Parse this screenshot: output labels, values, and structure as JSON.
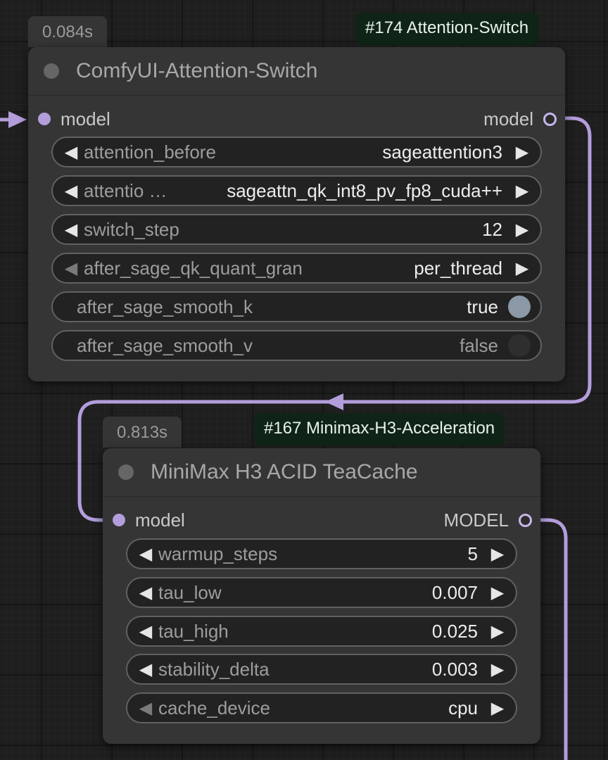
{
  "nodes": [
    {
      "timing": "0.084s",
      "badge": "#174 Attention-Switch",
      "title": "ComfyUI-Attention-Switch",
      "input": "model",
      "output": "model",
      "widgets": [
        {
          "label": "attention_before",
          "value": "sageattention3"
        },
        {
          "label": "attentio …",
          "value": "sageattn_qk_int8_pv_fp8_cuda++"
        },
        {
          "label": "switch_step",
          "value": "12"
        },
        {
          "label": "after_sage_qk_quant_gran",
          "value": "per_thread"
        },
        {
          "label": "after_sage_smooth_k",
          "value": "true"
        },
        {
          "label": "after_sage_smooth_v",
          "value": "false"
        }
      ]
    },
    {
      "timing": "0.813s",
      "badge": "#167 Minimax-H3-Acceleration",
      "title": "MiniMax H3 ACID TeaCache",
      "input": "model",
      "output": "MODEL",
      "widgets": [
        {
          "label": "warmup_steps",
          "value": "5"
        },
        {
          "label": "tau_low",
          "value": "0.007"
        },
        {
          "label": "tau_high",
          "value": "0.025"
        },
        {
          "label": "stability_delta",
          "value": "0.003"
        },
        {
          "label": "cache_device",
          "value": "cpu"
        }
      ]
    }
  ],
  "icons": {
    "decrement": "triangle-left-icon",
    "increment": "triangle-right-icon",
    "status": "status-dot-icon"
  },
  "colors": {
    "canvas": "#1e1e1e",
    "node_body": "#353535",
    "badge_bg": "#0f2417",
    "link": "#b39ddb",
    "widget_bg": "#222222",
    "toggle_on": "#8b98a6"
  }
}
